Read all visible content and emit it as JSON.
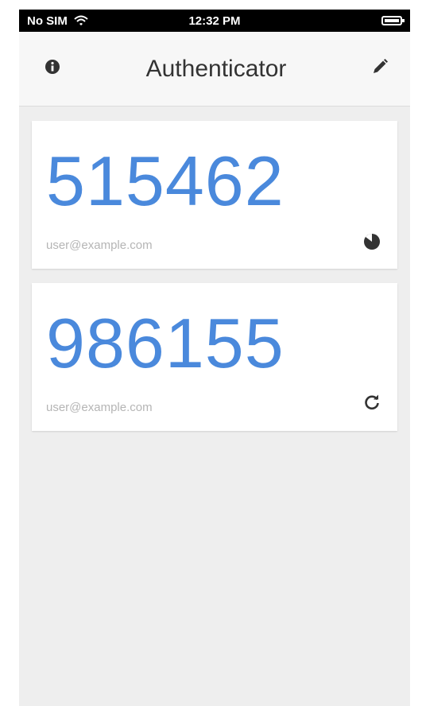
{
  "status_bar": {
    "carrier": "No SIM",
    "time": "12:32 PM",
    "wifi_icon": "wifi-icon",
    "battery_icon": "battery-icon"
  },
  "app_bar": {
    "title": "Authenticator",
    "info_icon": "info-icon",
    "edit_icon": "pencil-icon"
  },
  "accounts": [
    {
      "code": "515462",
      "account": "user@example.com",
      "action_icon": "countdown-timer-icon"
    },
    {
      "code": "986155",
      "account": "user@example.com",
      "action_icon": "refresh-icon"
    }
  ],
  "colors": {
    "code": "#4a89dc",
    "account_text": "#b5b5b5",
    "background": "#eeeeee"
  }
}
